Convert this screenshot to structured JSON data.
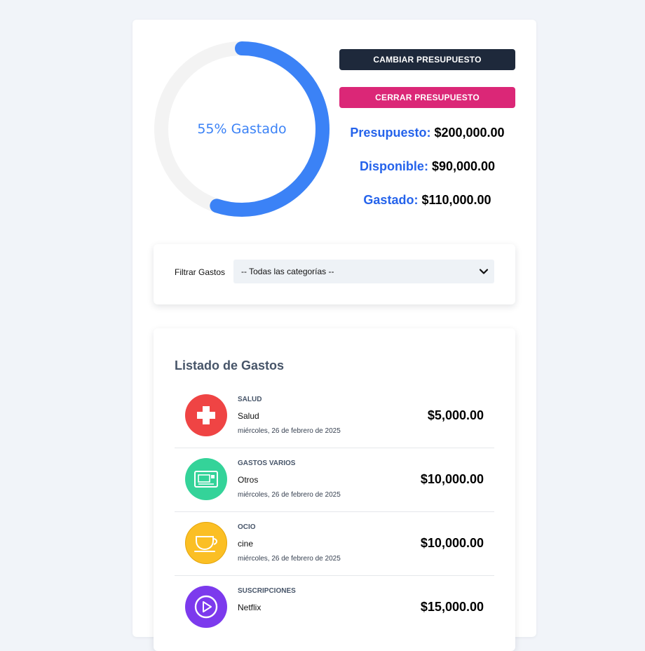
{
  "progress": {
    "percent": 55,
    "label": "55% Gastado",
    "track_color": "#f3f3f3",
    "bar_color": "#3b82f6"
  },
  "buttons": {
    "change_budget": "CAMBIAR PRESUPUESTO",
    "close_budget": "CERRAR PRESUPUESTO"
  },
  "stats": {
    "budget_label": "Presupuesto:",
    "budget_value": "$200,000.00",
    "available_label": "Disponible:",
    "available_value": "$90,000.00",
    "spent_label": "Gastado:",
    "spent_value": "$110,000.00"
  },
  "filter": {
    "label": "Filtrar Gastos",
    "selected": "-- Todas las categorías --"
  },
  "list": {
    "title": "Listado de Gastos",
    "items": [
      {
        "category": "SALUD",
        "name": "Salud",
        "date": "miércoles, 26 de febrero de 2025",
        "amount": "$5,000.00",
        "icon": "health-cross-icon",
        "color": "#ef4444"
      },
      {
        "category": "GASTOS VARIOS",
        "name": "Otros",
        "date": "miércoles, 26 de febrero de 2025",
        "amount": "$10,000.00",
        "icon": "misc-card-icon",
        "color": "#34d399"
      },
      {
        "category": "OCIO",
        "name": "cine",
        "date": "miércoles, 26 de febrero de 2025",
        "amount": "$10,000.00",
        "icon": "coffee-cup-icon",
        "color": "#fbbf24"
      },
      {
        "category": "SUSCRIPCIONES",
        "name": "Netflix",
        "date": "",
        "amount": "$15,000.00",
        "icon": "play-icon",
        "color": "#7c3aed"
      }
    ]
  }
}
